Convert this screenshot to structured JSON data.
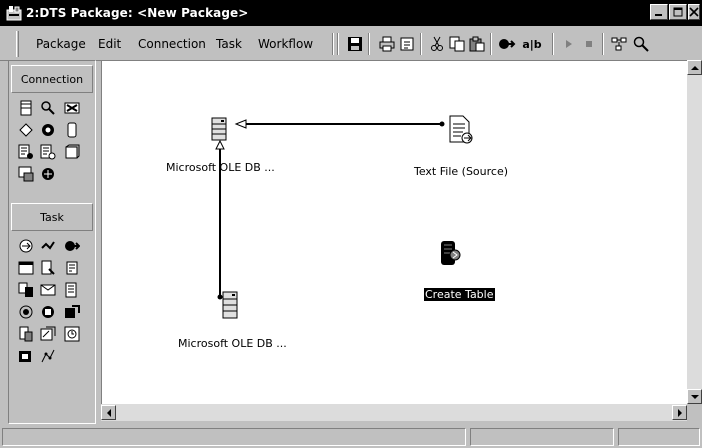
{
  "window": {
    "title": "2:DTS Package: <New Package>"
  },
  "menu": {
    "items": [
      "Package",
      "Edit",
      "Connection",
      "Task",
      "Workflow"
    ]
  },
  "toolbar": {
    "icons": [
      "save-icon",
      "print-icon",
      "properties-icon",
      "cut-icon",
      "copy-icon",
      "paste-icon",
      "transform-icon",
      "workflow-icon",
      "run-icon",
      "stop-icon",
      "layout-icon",
      "zoom-icon"
    ],
    "workflow_label": "a|b"
  },
  "palette": {
    "connection_header": "Connection",
    "task_header": "Task"
  },
  "canvas": {
    "nodes": {
      "oledb_top": "Microsoft OLE DB ...",
      "text_file": "Text File (Source)",
      "create_table": "Create Table",
      "oledb_bottom": "Microsoft OLE DB ..."
    }
  },
  "colors": {
    "titlebar": "#000000",
    "face": "#c0c0c0",
    "canvas": "#ffffff"
  }
}
